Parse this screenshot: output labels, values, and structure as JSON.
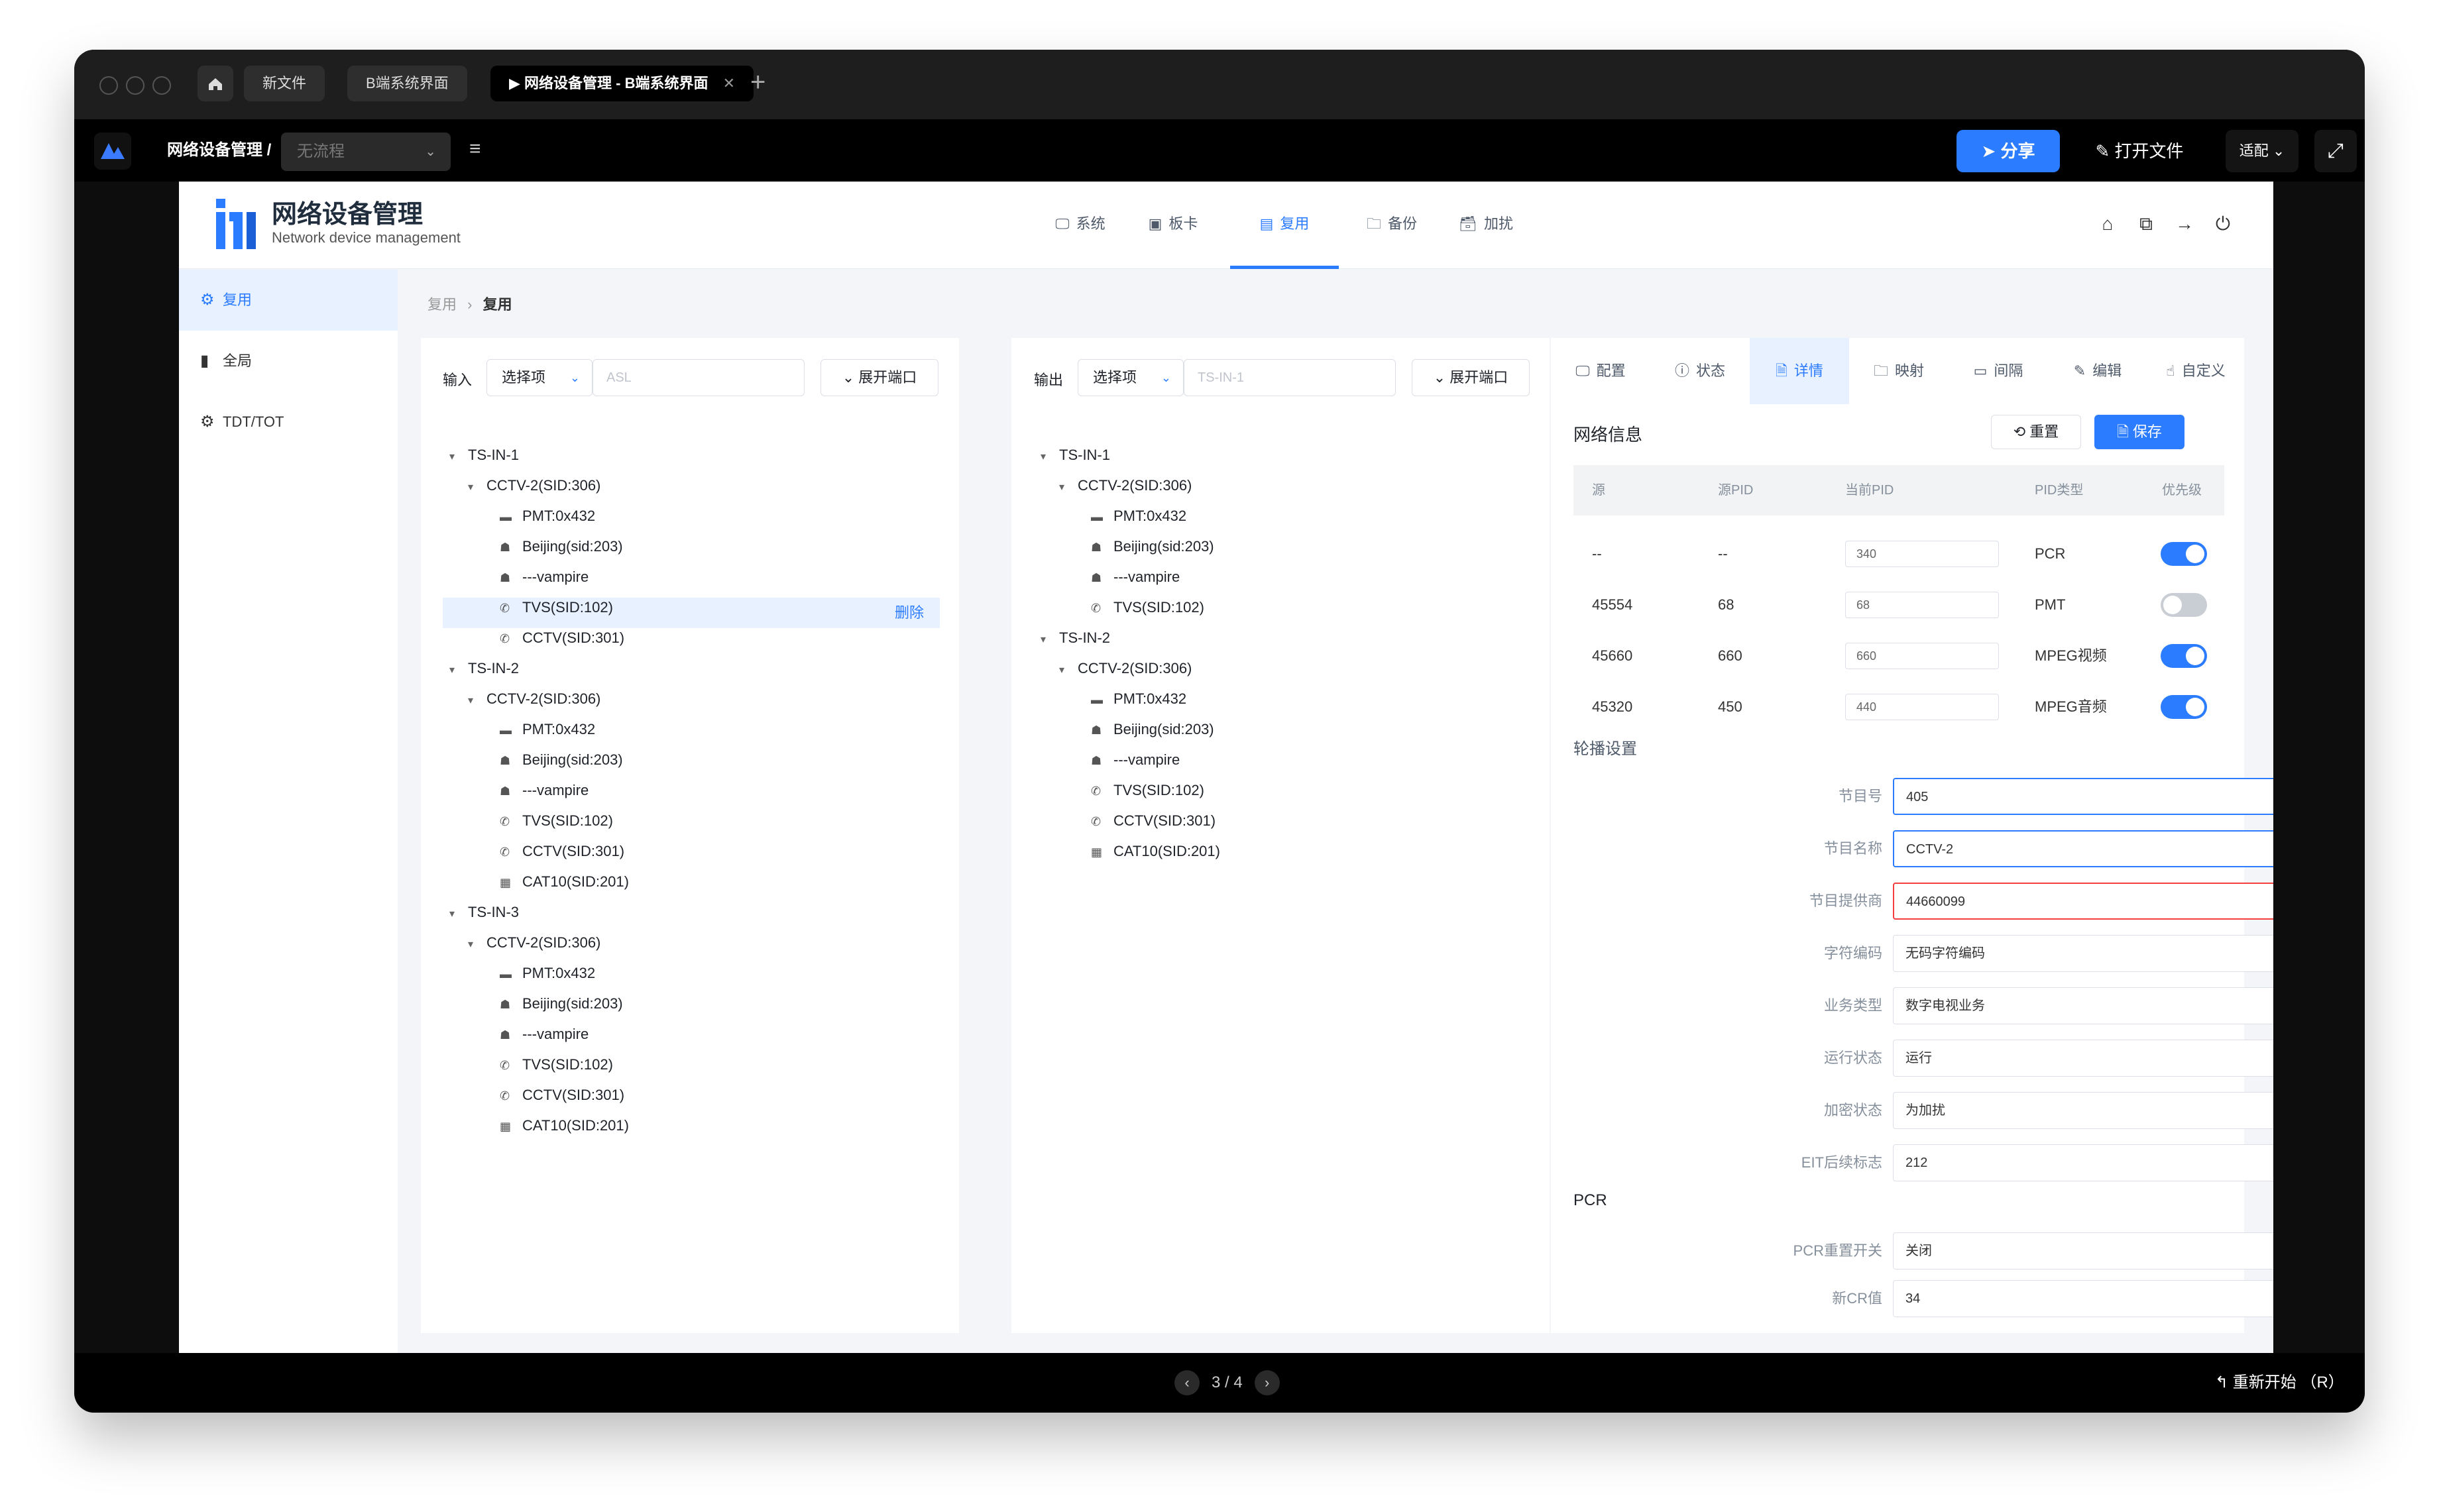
{
  "window": {
    "tabs": [
      "新文件",
      "B端系统界面",
      "网络设备管理 - B端系统界面"
    ],
    "active_tab_prefix": "▶",
    "breadcrumb_title": "网络设备管理 /",
    "flow_select": "无流程",
    "share": "分享",
    "open_file": "打开文件",
    "fit": "适配",
    "pager": "3 / 4",
    "restart": "重新开始 （R）"
  },
  "app": {
    "title": "网络设备管理",
    "subtitle": "Network device management",
    "nav": [
      {
        "label": "系统",
        "icon": "🖵"
      },
      {
        "label": "板卡",
        "icon": "▣"
      },
      {
        "label": "复用",
        "icon": "▤"
      },
      {
        "label": "备份",
        "icon": "🗀"
      },
      {
        "label": "加扰",
        "icon": "🗃"
      }
    ],
    "sidebar": [
      {
        "label": "复用",
        "icon": "⚙"
      },
      {
        "label": "全局",
        "icon": "▮"
      },
      {
        "label": "TDT/TOT",
        "icon": "⚙"
      }
    ],
    "breadcrumb": {
      "parent": "复用",
      "sep": "›",
      "current": "复用"
    }
  },
  "input_panel": {
    "label": "输入",
    "select": "选择项",
    "search_placeholder": "ASL",
    "expand": "展开端口",
    "delete": "删除",
    "tree": [
      {
        "level": 0,
        "text": "TS-IN-1",
        "arrow": true,
        "icon": ""
      },
      {
        "level": 1,
        "text": "CCTV-2(SID:306)",
        "arrow": true,
        "icon": ""
      },
      {
        "level": 2,
        "text": "PMT:0x432",
        "icon": "▬"
      },
      {
        "level": 2,
        "text": "Beijing(sid:203)",
        "icon": "☗"
      },
      {
        "level": 2,
        "text": "---vampire",
        "icon": "☗"
      },
      {
        "level": 2,
        "text": "TVS(SID:102)",
        "icon": "✆"
      },
      {
        "level": 2,
        "text": "CCTV(SID:301)",
        "icon": "✆",
        "selected": true
      },
      {
        "level": 0,
        "text": "TS-IN-2",
        "arrow": true,
        "icon": ""
      },
      {
        "level": 1,
        "text": "CCTV-2(SID:306)",
        "arrow": true,
        "icon": ""
      },
      {
        "level": 2,
        "text": "PMT:0x432",
        "icon": "▬"
      },
      {
        "level": 2,
        "text": "Beijing(sid:203)",
        "icon": "☗"
      },
      {
        "level": 2,
        "text": "---vampire",
        "icon": "☗"
      },
      {
        "level": 2,
        "text": "TVS(SID:102)",
        "icon": "✆"
      },
      {
        "level": 2,
        "text": "CCTV(SID:301)",
        "icon": "✆"
      },
      {
        "level": 2,
        "text": "CAT10(SID:201)",
        "icon": "▦"
      },
      {
        "level": 0,
        "text": "TS-IN-3",
        "arrow": true,
        "icon": ""
      },
      {
        "level": 1,
        "text": "CCTV-2(SID:306)",
        "arrow": true,
        "icon": ""
      },
      {
        "level": 2,
        "text": "PMT:0x432",
        "icon": "▬"
      },
      {
        "level": 2,
        "text": "Beijing(sid:203)",
        "icon": "☗"
      },
      {
        "level": 2,
        "text": "---vampire",
        "icon": "☗"
      },
      {
        "level": 2,
        "text": "TVS(SID:102)",
        "icon": "✆"
      },
      {
        "level": 2,
        "text": "CCTV(SID:301)",
        "icon": "✆"
      },
      {
        "level": 2,
        "text": "CAT10(SID:201)",
        "icon": "▦"
      }
    ]
  },
  "transfer_buttons": [
    "»",
    "«",
    "⟲",
    "✓"
  ],
  "output_panel": {
    "label": "输出",
    "select": "选择项",
    "search_placeholder": "TS-IN-1",
    "expand": "展开端口",
    "tree": [
      {
        "level": 0,
        "text": "TS-IN-1",
        "arrow": true,
        "icon": ""
      },
      {
        "level": 1,
        "text": "CCTV-2(SID:306)",
        "arrow": true,
        "icon": ""
      },
      {
        "level": 2,
        "text": "PMT:0x432",
        "icon": "▬"
      },
      {
        "level": 2,
        "text": "Beijing(sid:203)",
        "icon": "☗"
      },
      {
        "level": 2,
        "text": "---vampire",
        "icon": "☗"
      },
      {
        "level": 2,
        "text": "TVS(SID:102)",
        "icon": "✆"
      },
      {
        "level": 0,
        "text": "TS-IN-2",
        "arrow": true,
        "icon": ""
      },
      {
        "level": 1,
        "text": "CCTV-2(SID:306)",
        "arrow": true,
        "icon": ""
      },
      {
        "level": 2,
        "text": "PMT:0x432",
        "icon": "▬"
      },
      {
        "level": 2,
        "text": "Beijing(sid:203)",
        "icon": "☗"
      },
      {
        "level": 2,
        "text": "---vampire",
        "icon": "☗"
      },
      {
        "level": 2,
        "text": "TVS(SID:102)",
        "icon": "✆"
      },
      {
        "level": 2,
        "text": "CCTV(SID:301)",
        "icon": "✆"
      },
      {
        "level": 2,
        "text": "CAT10(SID:201)",
        "icon": "▦"
      }
    ]
  },
  "detail": {
    "tabs": [
      {
        "label": "配置",
        "icon": "🖵"
      },
      {
        "label": "状态",
        "icon": "ⓘ"
      },
      {
        "label": "详情",
        "icon": "🗎"
      },
      {
        "label": "映射",
        "icon": "🗀"
      },
      {
        "label": "间隔",
        "icon": "▭"
      },
      {
        "label": "编辑",
        "icon": "✎"
      },
      {
        "label": "自定义",
        "icon": "☝"
      }
    ],
    "network_title": "网络信息",
    "reset": "重置",
    "save": "保存",
    "table_headers": [
      "源",
      "源PID",
      "当前PID",
      "PID类型",
      "优先级"
    ],
    "rows": [
      {
        "src": "--",
        "src_pid": "--",
        "cur_pid": "340",
        "type": "PCR",
        "on": true
      },
      {
        "src": "45554",
        "src_pid": "68",
        "cur_pid": "68",
        "type": "PMT",
        "on": false
      },
      {
        "src": "45660",
        "src_pid": "660",
        "cur_pid": "660",
        "type": "MPEG视频",
        "on": true
      },
      {
        "src": "45320",
        "src_pid": "450",
        "cur_pid": "440",
        "type": "MPEG音频",
        "on": true
      }
    ],
    "carousel_title": "轮播设置",
    "form": [
      {
        "label": "节目号",
        "value": "405",
        "state": "valid"
      },
      {
        "label": "节目名称",
        "value": "CCTV-2",
        "state": "focus"
      },
      {
        "label": "节目提供商",
        "value": "44660099",
        "state": "error"
      },
      {
        "label": "字符编码",
        "value": "无码字符编码",
        "state": "select"
      },
      {
        "label": "业务类型",
        "value": "数字电视业务",
        "state": "select"
      },
      {
        "label": "运行状态",
        "value": "运行",
        "state": "select"
      },
      {
        "label": "加密状态",
        "value": "为加扰",
        "state": "select"
      },
      {
        "label": "EIT后续标志",
        "value": "212",
        "state": "select"
      }
    ],
    "pcr_title": "PCR",
    "pcr_form": [
      {
        "label": "PCR重置开关",
        "value": "关闭"
      },
      {
        "label": "新CR值",
        "value": "34"
      }
    ]
  },
  "colors": {
    "accent": "#2b7cff",
    "error": "#f53f3f",
    "selected_bg": "#e8f1ff"
  }
}
